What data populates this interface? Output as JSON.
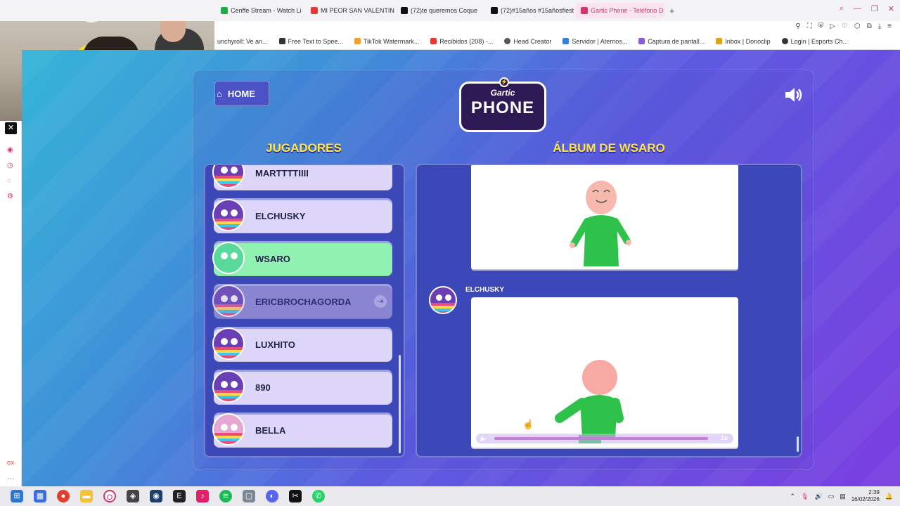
{
  "browser": {
    "tabs": [
      {
        "label": "Cenffe Stream - Watch Li",
        "color": "#22aa44"
      },
      {
        "label": "MI PEOR SAN VALENTIN",
        "color": "#e53935"
      },
      {
        "label": "(72)te queremos Coque",
        "color": "#111111"
      },
      {
        "label": "(72)#15años #15añosfiest",
        "color": "#111111"
      },
      {
        "label": "Gartic Phone - Teléfono D",
        "color": "#d63372",
        "active": true
      }
    ],
    "new_tab": "+",
    "bookmarks": [
      "unchyroll: Ve an...",
      "Free Text to Spee...",
      "TikTok Watermark...",
      "Recibidos (208) -...",
      "Head Creator",
      "Servidor | Aternos...",
      "Captura de pantall...",
      "Inbox | Donoclip",
      "Login | Esports Ch..."
    ]
  },
  "game": {
    "home_label": "HOME",
    "logo_line1": "Gartic",
    "logo_line2": "PHONE",
    "players_title": "JUGADORES",
    "album_title": "ÁLBUM DE WSARO",
    "players": [
      {
        "name": "MARTTTTIIII",
        "state": "normal"
      },
      {
        "name": "ELCHUSKY",
        "state": "normal"
      },
      {
        "name": "WSARO",
        "state": "current"
      },
      {
        "name": "ERICBROCHAGORDA",
        "state": "left"
      },
      {
        "name": "LUXHITO",
        "state": "normal"
      },
      {
        "name": "890",
        "state": "normal"
      },
      {
        "name": "BELLA",
        "state": "normal"
      }
    ],
    "album_author": "ELCHUSKY",
    "playback_speed": "1x",
    "accent": "#ffe44a"
  },
  "taskbar": {
    "time": "2:39",
    "date": "16/02/2026"
  }
}
